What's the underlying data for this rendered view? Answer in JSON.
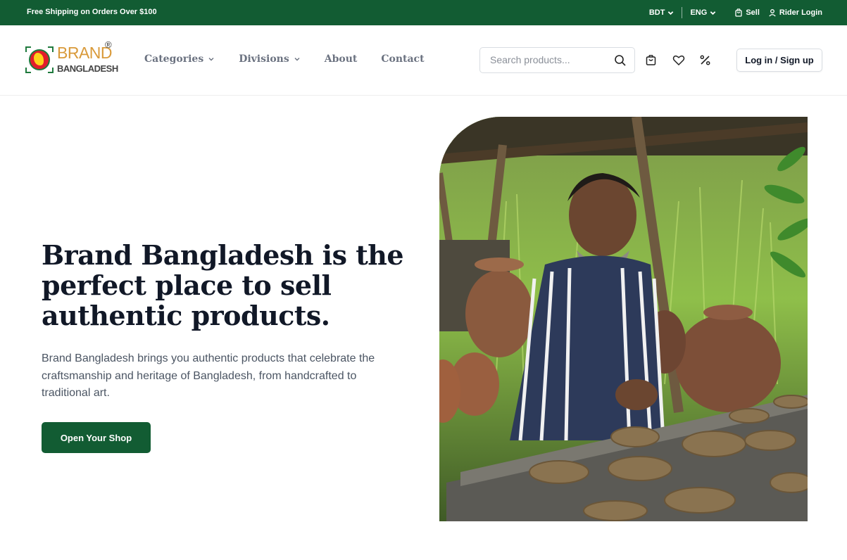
{
  "topbar": {
    "promo": "Free Shipping on Orders Over $100",
    "currency": "BDT",
    "language": "ENG",
    "sell": "Sell",
    "rider_login": "Rider Login"
  },
  "header": {
    "logo": {
      "brand": "BRAND",
      "sub": "BANGLADESH",
      "reg": "®"
    },
    "nav": [
      {
        "label": "Categories",
        "has_dropdown": true
      },
      {
        "label": "Divisions",
        "has_dropdown": true
      },
      {
        "label": "About",
        "has_dropdown": false
      },
      {
        "label": "Contact",
        "has_dropdown": false
      }
    ],
    "search": {
      "placeholder": "Search products..."
    },
    "icons": [
      "cart-icon",
      "heart-icon",
      "percent-icon"
    ],
    "login_label": "Log in / Sign up"
  },
  "hero": {
    "title": "Brand Bangladesh is the perfect place to sell authentic products.",
    "description": "Brand Bangladesh brings you authentic products that celebrate the craftsmanship and heritage of Bangladesh, from handcrafted to traditional art.",
    "cta_label": "Open Your Shop"
  },
  "colors": {
    "primary_green": "#125c33",
    "logo_gold": "#d99a3a",
    "flag_red": "#e21d2b"
  }
}
